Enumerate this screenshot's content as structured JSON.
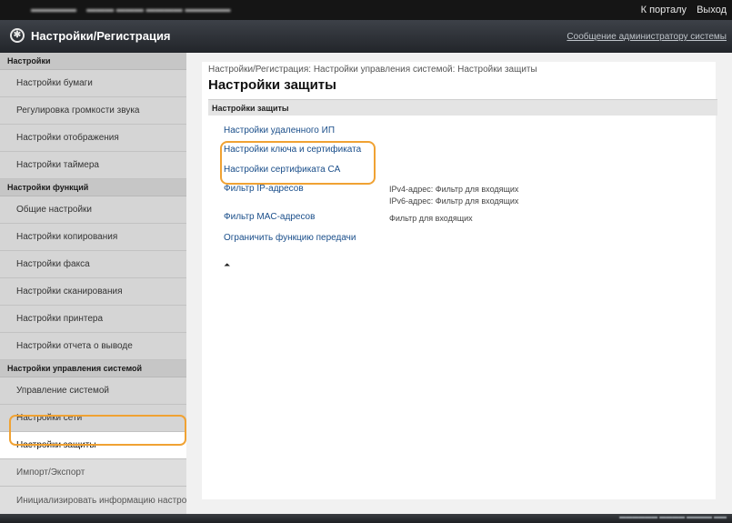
{
  "topbar": {
    "device_name": "",
    "links": [
      "К порталу",
      "Выход"
    ]
  },
  "header": {
    "title": "Настройки/Регистрация",
    "admin_message": "Сообщение администратору системы"
  },
  "sidebar": {
    "sections": [
      {
        "heading": "Настройки",
        "items": [
          "Настройки бумаги",
          "Регулировка громкости звука",
          "Настройки отображения",
          "Настройки таймера"
        ]
      },
      {
        "heading": "Настройки функций",
        "items": [
          "Общие настройки",
          "Настройки копирования",
          "Настройки факса",
          "Настройки сканирования",
          "Настройки принтера",
          "Настройки отчета о выводе"
        ]
      },
      {
        "heading": "Настройки управления системой",
        "items": [
          "Управление системой",
          "Настройки сети",
          "Настройки защиты",
          "Импорт/Экспорт",
          "Инициализировать информацию настроек"
        ]
      }
    ]
  },
  "main": {
    "breadcrumb": "Настройки/Регистрация: Настройки управления системой: Настройки защиты",
    "title": "Настройки защиты",
    "group_heading": "Настройки защиты",
    "rows": [
      {
        "link": "Настройки удаленного ИП",
        "desc": ""
      },
      {
        "link": "Настройки ключа и сертификата",
        "desc": ""
      },
      {
        "link": "Настройки сертификата CA",
        "desc": ""
      },
      {
        "link": "Фильтр IP-адресов",
        "desc": "IPv4-адрес: Фильтр для входящих",
        "desc2": "IPv6-адрес: Фильтр для входящих"
      },
      {
        "link": "Фильтр MAC-адресов",
        "desc": "Фильтр для входящих"
      },
      {
        "link": "Ограничить функцию передачи",
        "desc": ""
      }
    ]
  },
  "colors": {
    "highlight": "#f0a233",
    "link": "#1a4e8a",
    "header_bg": "#22252a"
  }
}
